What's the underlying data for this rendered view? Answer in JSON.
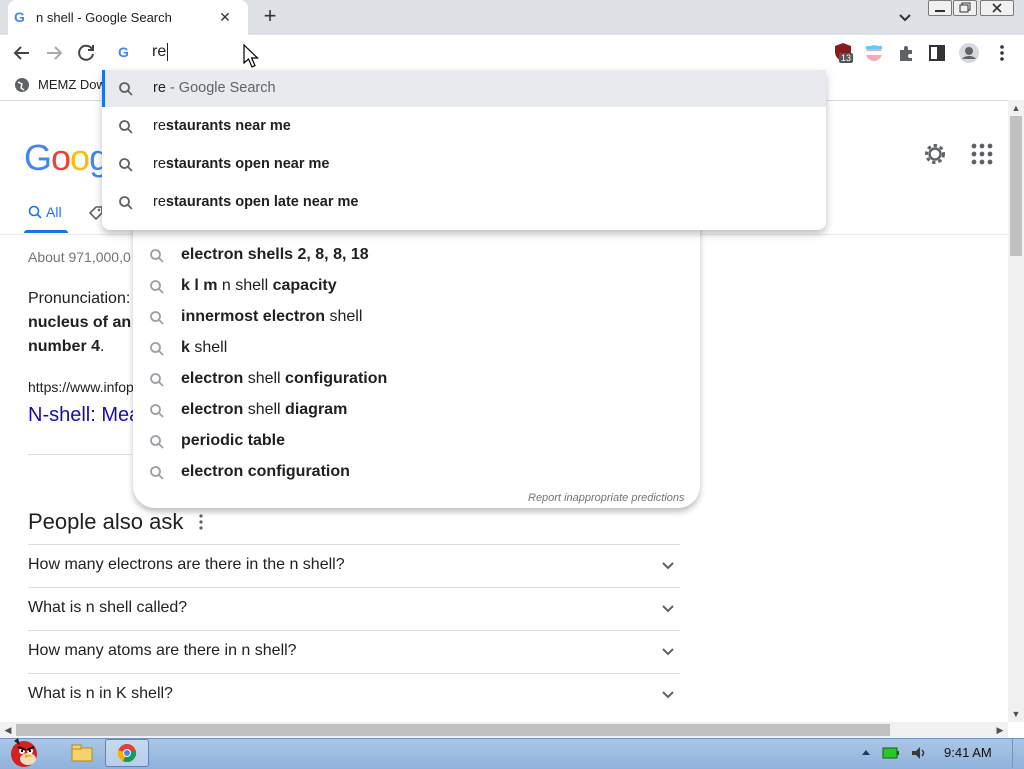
{
  "browser": {
    "tab_title": "n shell - Google Search",
    "tab_favicon": "G",
    "new_tab": "+",
    "close_tab": "✕",
    "omnibox_text": "re",
    "omnibox_favicon": "G",
    "bookmark_label": "MEMZ Dow",
    "extension_badge": "13"
  },
  "omnibox_suggestions": {
    "top": {
      "typed": "re",
      "rest": " - Google Search"
    },
    "items": [
      {
        "typed": "re",
        "bold": "staurants near me"
      },
      {
        "typed": "re",
        "bold": "staurants open near me"
      },
      {
        "typed": "re",
        "bold": "staurants open late near me"
      }
    ]
  },
  "page": {
    "logo": "Googl",
    "tab_all": "All",
    "result_stats": "About 971,000,0",
    "pron": "Pronunciation:",
    "snippet_bold": "nucleus of an a",
    "snippet_3_bold": "number 4",
    "snippet_3_rest": ".",
    "result_url": "https://www.infop",
    "result_title": "N-shell: Mea"
  },
  "page_autocomplete": {
    "items": [
      {
        "pre": "",
        "b1": "electron shells 2, 8, 8, 18",
        "mid": "",
        "b2": ""
      },
      {
        "pre": "",
        "b1": "k l m",
        "mid": " n shell ",
        "b2": "capacity"
      },
      {
        "pre": "",
        "b1": "innermost electron",
        "mid": " shell",
        "b2": ""
      },
      {
        "pre": "",
        "b1": "k",
        "mid": " shell",
        "b2": ""
      },
      {
        "pre": "",
        "b1": "electron",
        "mid": " shell ",
        "b2": "configuration"
      },
      {
        "pre": "",
        "b1": "electron",
        "mid": " shell ",
        "b2": "diagram"
      },
      {
        "pre": "",
        "b1": "periodic table",
        "mid": "",
        "b2": ""
      },
      {
        "pre": "",
        "b1": "electron configuration",
        "mid": "",
        "b2": ""
      }
    ],
    "report": "Report inappropriate predictions"
  },
  "people_also_ask": {
    "title": "People also ask",
    "questions": [
      "How many electrons are there in the n shell?",
      "What is n shell called?",
      "How many atoms are there in n shell?",
      "What is n in K shell?"
    ]
  },
  "taskbar": {
    "clock": "9:41 AM"
  },
  "colors": {
    "accent": "#1a73e8",
    "link": "#1a0dab",
    "taskbar": "#a9c6e6"
  }
}
